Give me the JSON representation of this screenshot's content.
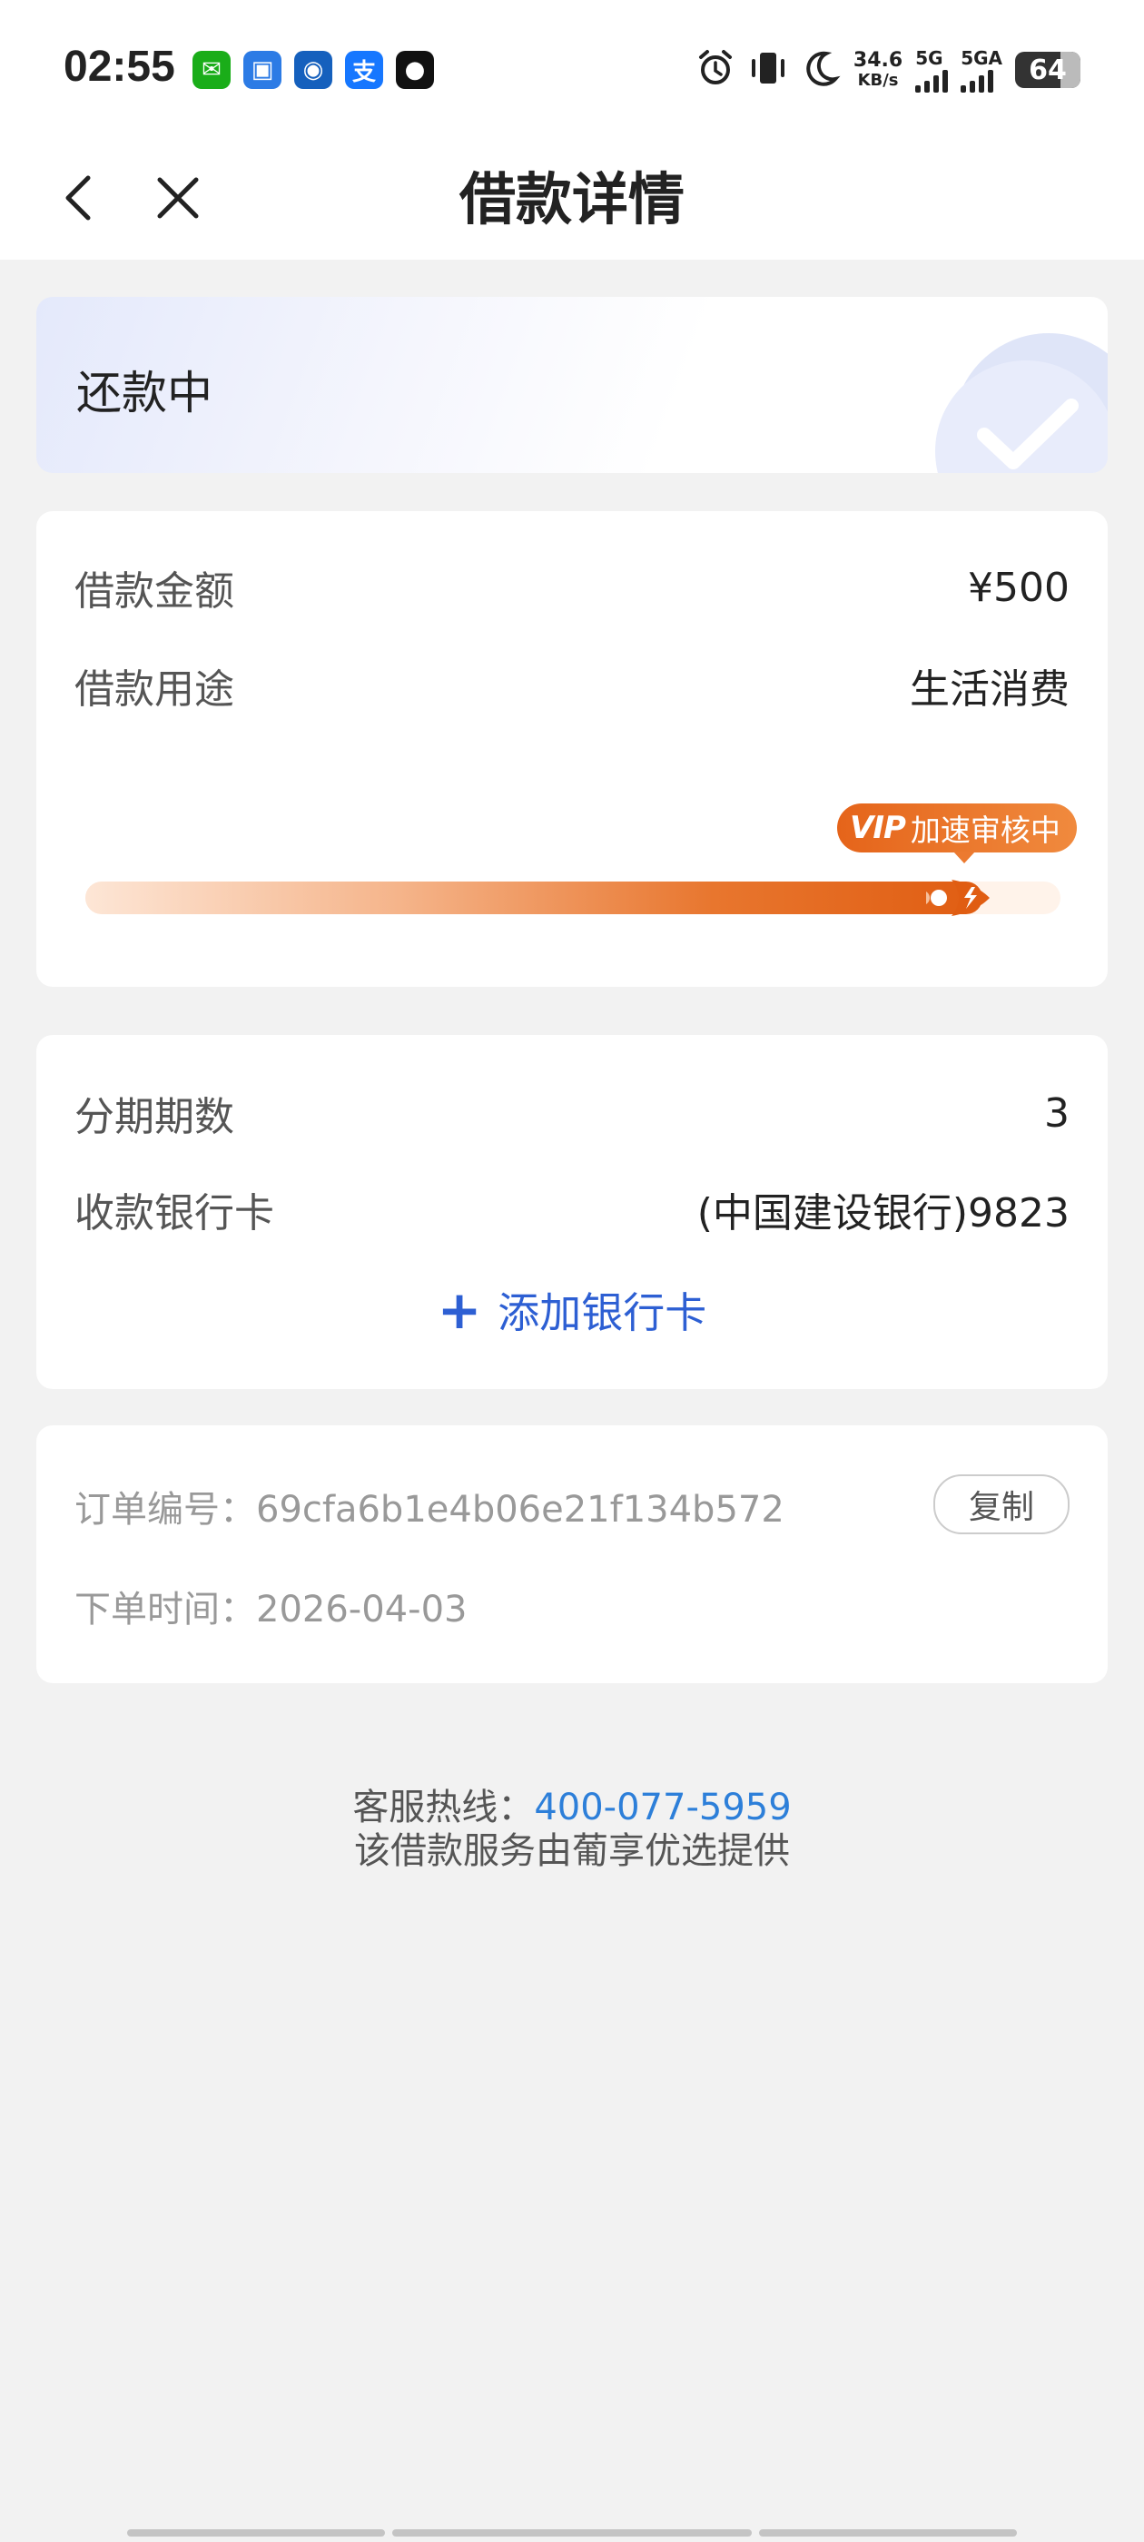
{
  "status_bar": {
    "time": "02:55",
    "apps": [
      {
        "name": "wechat-icon",
        "glyph": "✉",
        "color": "#1aad19"
      },
      {
        "name": "app-blue-icon",
        "glyph": "▣",
        "color": "#2c7be5"
      },
      {
        "name": "ccb-icon",
        "glyph": "◉",
        "color": "#1560bd"
      },
      {
        "name": "alipay-icon",
        "glyph": "支",
        "color": "#1677ff"
      },
      {
        "name": "qq-icon",
        "glyph": "●",
        "color": "#111111"
      }
    ],
    "speed_value": "34.6",
    "speed_unit": "KB/s",
    "signal1_label": "5G",
    "signal2_label": "5GA",
    "battery": "64"
  },
  "nav": {
    "title": "借款详情"
  },
  "status_card": {
    "status": "还款中"
  },
  "loan": {
    "amount_label": "借款金额",
    "amount_value": "¥500",
    "purpose_label": "借款用途",
    "purpose_value": "生活消费",
    "badge_vip": "VIP",
    "badge_text": "加速审核中",
    "progress": 0.92
  },
  "installment": {
    "periods_label": "分期期数",
    "periods_value": "3",
    "card_label": "收款银行卡",
    "card_value": "(中国建设银行)9823",
    "add_card": "添加银行卡"
  },
  "order": {
    "number_label": "订单编号：",
    "number_value": "69cfa6b1e4b06e21f134b572",
    "copy": "复制",
    "time_label": "下单时间：",
    "time_value": "2026-04-03"
  },
  "footer": {
    "hotline_label": "客服热线：",
    "hotline_value": "400-077-5959",
    "provider": "该借款服务由葡享优选提供"
  },
  "colors": {
    "accent_blue": "#2d5fd3",
    "orange": "#e5641a"
  }
}
